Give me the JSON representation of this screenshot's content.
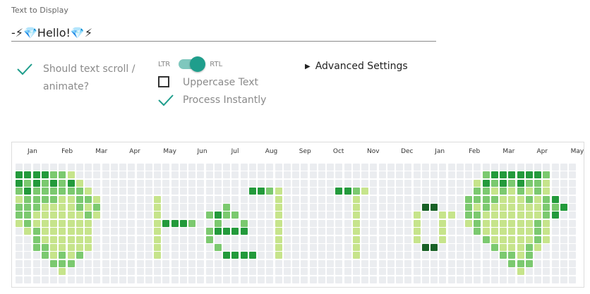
{
  "input": {
    "label": "Text to Display",
    "value": "-⚡💎Hello!💎⚡"
  },
  "options": {
    "scroll_label_line1": "Should text scroll /",
    "scroll_label_line2": "animate?",
    "ltr": "LTR",
    "rtl": "RTL",
    "uppercase": "Uppercase Text",
    "instant": "Process Instantly"
  },
  "advanced": {
    "label": "Advanced Settings"
  },
  "graph": {
    "months": [
      "Jan",
      "Feb",
      "Mar",
      "Apr",
      "May",
      "Jun",
      "Jul",
      "Aug",
      "Sep",
      "Oct",
      "Nov",
      "Dec",
      "Jan",
      "Feb",
      "Mar",
      "Apr",
      "May"
    ],
    "colors": [
      "#ebedf0",
      "#c6e48b",
      "#7bc96f",
      "#239a3b",
      "#196127"
    ],
    "grid": [
      "00000000000000000000000000000000000000000000000000000000000000000",
      "33332210000000000000000000000000000000000000000000000023333332000",
      "32323231000000000000000000000000000000000000000000000132323221000",
      "23222222100000000000000000033210000003321000000000000221212121000",
      "12222112210000001000000000000010000000010000000000002222111212300",
      "22211112120000001000000020000010000000010000000440002121111112230",
      "22111111210000001000002322000010000000010000001001102211111112300",
      "12111111100000001333200200200010000000010000001001001211111121000",
      "01211111100000001000002333300010000000010000001001000211111121000",
      "00211111100000001000002000000010000000010000001001000021111121000",
      "00221111100000001000000200000010000000010000000440000002111210000",
      "00021212000000001000000033330010000000010000000000000000221200000",
      "00002220000000000000000000000000000000000000000000000000022200000",
      "00000100000000000000000000000000000000000000000000000000001000000",
      "00000000000000000000000000000000000000000000000000000000000000000"
    ]
  }
}
